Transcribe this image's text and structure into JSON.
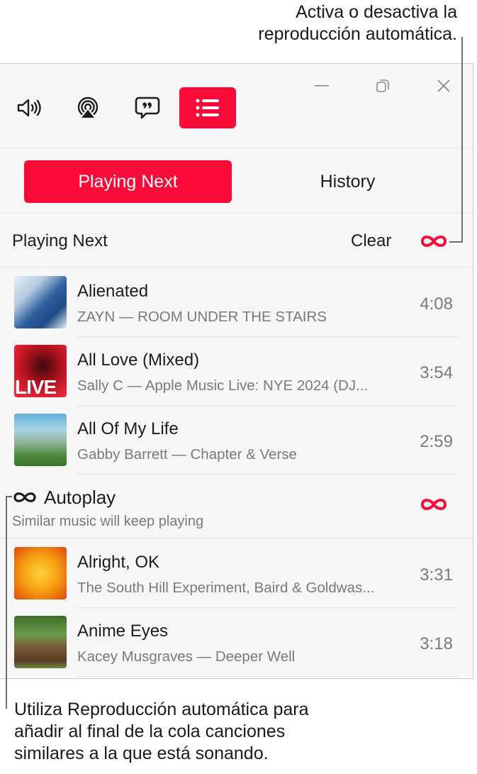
{
  "callouts": {
    "top_line1": "Activa o desactiva la",
    "top_line2": "reproducción automática.",
    "bottom_line1": "Utiliza Reproducción automática para",
    "bottom_line2": "añadir al final de la cola canciones",
    "bottom_line3": "similares a la que está sonando."
  },
  "toolbar": {
    "buttons": [
      {
        "icon": "speaker-volume-icon",
        "active": false
      },
      {
        "icon": "airplay-icon",
        "active": false
      },
      {
        "icon": "lyrics-quote-icon",
        "active": false
      },
      {
        "icon": "queue-list-icon",
        "active": true
      }
    ],
    "window_controls": [
      "minimize-icon",
      "restore-icon",
      "close-icon"
    ]
  },
  "tabs": [
    {
      "label": "Playing Next",
      "active": true
    },
    {
      "label": "History",
      "active": false
    }
  ],
  "playing_next": {
    "title": "Playing Next",
    "clear_label": "Clear",
    "autoplay_enabled": true,
    "tracks": [
      {
        "title": "Alienated",
        "subtitle": "ZAYN — ROOM UNDER THE STAIRS",
        "duration": "4:08"
      },
      {
        "title": "All Love (Mixed)",
        "subtitle": "Sally C — Apple Music Live: NYE 2024 (DJ...",
        "duration": "3:54"
      },
      {
        "title": "All Of My Life",
        "subtitle": "Gabby Barrett — Chapter & Verse",
        "duration": "2:59"
      }
    ]
  },
  "autoplay": {
    "title": "Autoplay",
    "subtitle": "Similar music will keep playing",
    "tracks": [
      {
        "title": "Alright, OK",
        "subtitle": "The South Hill Experiment, Baird & Goldwas...",
        "duration": "3:31"
      },
      {
        "title": "Anime Eyes",
        "subtitle": "Kacey Musgraves — Deeper Well",
        "duration": "3:18"
      }
    ]
  },
  "colors": {
    "accent": "#fa0a38",
    "window_bg": "#f6f6f6",
    "secondary_text": "#7a7a7a"
  }
}
